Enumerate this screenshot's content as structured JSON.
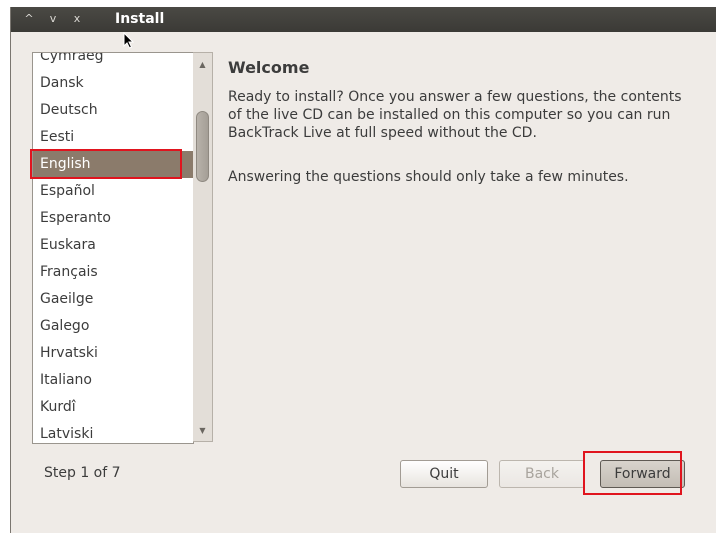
{
  "window": {
    "title": "Install",
    "controls": [
      "^",
      "v",
      "x"
    ]
  },
  "languages": {
    "items": [
      "Cymraeg",
      "Dansk",
      "Deutsch",
      "Eesti",
      "English",
      "Español",
      "Esperanto",
      "Euskara",
      "Français",
      "Gaeilge",
      "Galego",
      "Hrvatski",
      "Italiano",
      "Kurdî",
      "Latviski"
    ],
    "selected": "English"
  },
  "welcome": {
    "title": "Welcome",
    "paragraph1": "Ready to install?  Once you answer a few questions, the contents of the live CD can be installed on this computer so you can run BackTrack Live at full speed without the CD.",
    "paragraph2": "Answering the questions should only take a few minutes."
  },
  "footer": {
    "step": "Step 1 of 7",
    "quit_label": "Quit",
    "back_label": "Back",
    "forward_label": "Forward"
  },
  "colors": {
    "titlebar": "#3b3a36",
    "selection": "#8b7b6b",
    "highlight_box": "#e0141e"
  }
}
